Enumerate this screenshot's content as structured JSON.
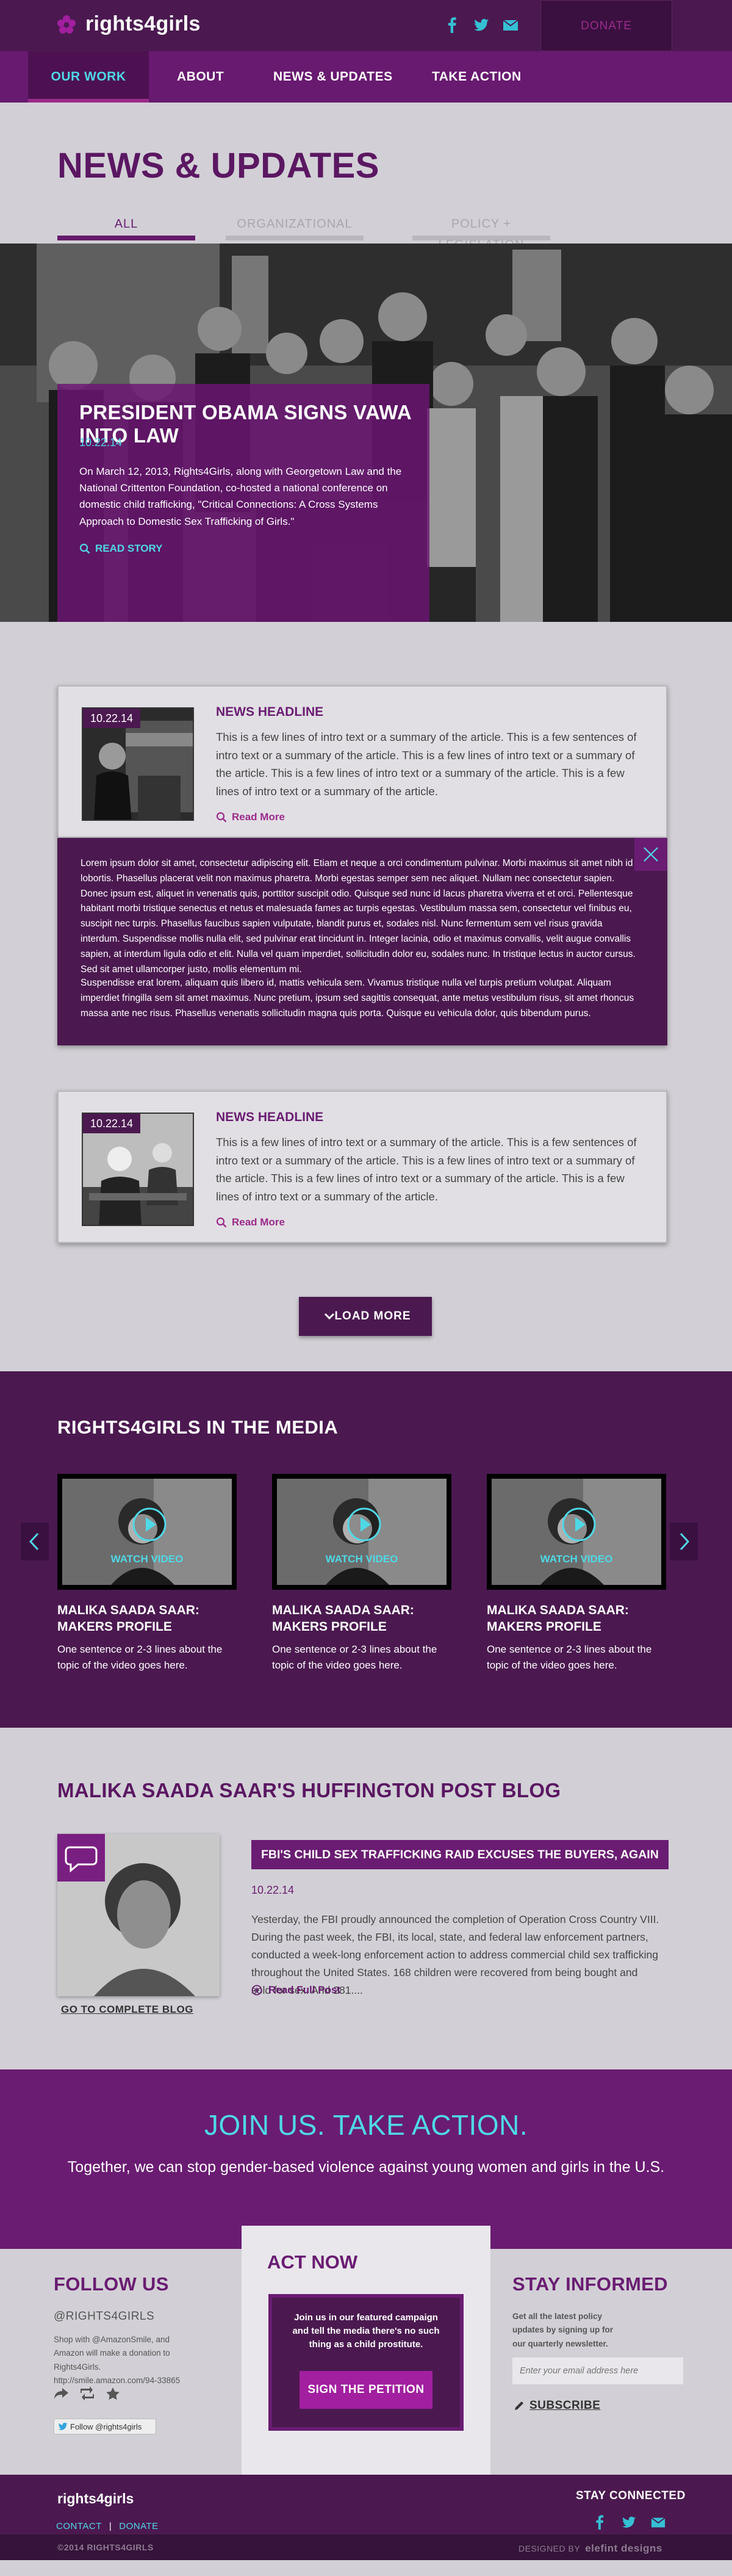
{
  "header": {
    "logo_text": "rights4girls",
    "social_icons": [
      "facebook-icon",
      "twitter-icon",
      "email-icon"
    ],
    "donate_label": "DONATE"
  },
  "nav": {
    "items": [
      {
        "label": "OUR WORK",
        "active": true
      },
      {
        "label": "ABOUT",
        "active": false
      },
      {
        "label": "NEWS & UPDATES",
        "active": false
      },
      {
        "label": "TAKE ACTION",
        "active": false
      }
    ]
  },
  "news": {
    "title": "NEWS & UPDATES",
    "filters": [
      {
        "label": "ALL",
        "active": true
      },
      {
        "label": "ORGANIZATIONAL",
        "active": false
      },
      {
        "label": "POLICY + LEGISLATION",
        "active": false
      }
    ]
  },
  "feature": {
    "title": "PRESIDENT OBAMA SIGNS VAWA INTO LAW",
    "date": "10.22.14",
    "body": "On March 12, 2013, Rights4Girls, along with Georgetown Law and the National Crittenton Foundation, co-hosted a national conference on domestic child trafficking, \"Critical Connections: A Cross Systems Approach to Domestic Sex Trafficking of Girls.\"",
    "read_story": "READ STORY"
  },
  "articles": [
    {
      "date": "10.22.14",
      "headline": "NEWS HEADLINE",
      "intro": "This is a few lines of intro text or a summary of the article. This is a few sentences of intro text or a summary of the article. This is a few lines of intro text or a summary of the article. This is a few lines of intro text or a summary of the article. This is a few lines of intro text or a summary of the article.",
      "read_more": "Read More"
    },
    {
      "date": "10.22.14",
      "headline": "NEWS HEADLINE",
      "intro": "This is a few lines of intro text or a summary of the article. This is a few sentences of intro text or a summary of the article. This is a few lines of intro text or a summary of the article. This is a few lines of intro text or a summary of the article. This is a few lines of intro text or a summary of the article.",
      "read_more": "Read More"
    }
  ],
  "expanded": {
    "para1": "Lorem ipsum dolor sit amet, consectetur adipiscing elit. Etiam et neque a orci condimentum pulvinar. Morbi maximus sit amet nibh id lobortis. Phasellus placerat velit non maximus pharetra. Morbi egestas semper sem nec aliquet. Nullam nec consectetur sapien. Donec ipsum est, aliquet in venenatis quis, porttitor suscipit odio. Quisque sed nunc id lacus pharetra viverra et et orci. Pellentesque habitant morbi tristique senectus et netus et malesuada fames ac turpis egestas. Vestibulum massa sem, consectetur vel finibus eu, suscipit nec turpis. Phasellus faucibus sapien vulputate, blandit purus et, sodales nisl. Nunc fermentum sem vel risus gravida interdum. Suspendisse mollis nulla elit, sed pulvinar erat tincidunt in. Integer lacinia, odio et maximus convallis, velit augue convallis sapien, at interdum ligula odio et elit. Nulla vel quam imperdiet, sollicitudin dolor eu, sodales nunc. In tristique lectus in auctor cursus. Sed sit amet ullamcorper justo, mollis elementum mi.",
    "para2": "Suspendisse erat lorem, aliquam quis libero id, mattis vehicula sem. Vivamus tristique nulla vel turpis pretium volutpat. Aliquam imperdiet fringilla sem sit amet maximus. Nunc pretium, ipsum sed sagittis consequat, ante metus vestibulum risus, sit amet rhoncus massa ante nec risus. Phasellus venenatis sollicitudin magna quis porta. Quisque eu vehicula dolor, quis bibendum purus."
  },
  "load_more": "LOAD MORE",
  "media": {
    "title": "RIGHTS4GIRLS IN THE MEDIA",
    "videos": [
      {
        "watch": "WATCH VIDEO",
        "title": "MALIKA SAADA SAAR: MAKERS PROFILE",
        "desc": "One sentence or 2-3 lines about the topic of the video goes here."
      },
      {
        "watch": "WATCH VIDEO",
        "title": "MALIKA SAADA SAAR: MAKERS PROFILE",
        "desc": "One sentence or 2-3 lines about the topic of the video goes here."
      },
      {
        "watch": "WATCH VIDEO",
        "title": "MALIKA SAADA SAAR: MAKERS PROFILE",
        "desc": "One sentence or 2-3 lines about the topic of the video goes here."
      }
    ]
  },
  "blog": {
    "title": "MALIKA SAADA SAAR'S HUFFINGTON POST BLOG",
    "link": "GO TO COMPLETE BLOG",
    "headline": "FBI'S CHILD SEX TRAFFICKING RAID EXCUSES THE BUYERS, AGAIN",
    "date": "10.22.14",
    "body": "Yesterday, the FBI proudly announced the completion of Operation Cross Country VIII. During the past week, the FBI, its local, state, and federal law enforcement partners, conducted a week-long enforcement action to address commercial child sex trafficking throughout the United States. 168 children were recovered from being bought and sold for sex. And 281....",
    "read_more": "Read Full Post"
  },
  "join": {
    "title": "JOIN US. TAKE ACTION.",
    "subtitle": "Together, we can stop gender-based violence against young women and girls in the U.S."
  },
  "follow": {
    "title": "FOLLOW US",
    "handle": "@RIGHTS4GIRLS",
    "text": "Shop with @AmazonSmile, and Amazon will make a donation to Rights4Girls. http://smile.amazon.com/94-33865",
    "icons": [
      "share-icon",
      "retweet-icon",
      "star-icon"
    ],
    "twitter_button": "Follow @rights4girls"
  },
  "act": {
    "title": "ACT NOW",
    "text": "Join us in our featured campaign and tell the media there's no such thing as a child prostitute.",
    "button": "SIGN THE PETITION"
  },
  "stay": {
    "title": "STAY INFORMED",
    "text": "Get all the latest policy updates by signing up for our quarterly newsletter.",
    "placeholder": "Enter your email address here",
    "subscribe": "SUBSCRIBE"
  },
  "footer": {
    "logo": "rights4girls",
    "links": [
      "CONTACT",
      "DONATE"
    ],
    "separator": "|",
    "stay_connected": "STAY CONNECTED",
    "icons": [
      "facebook-icon",
      "twitter-icon",
      "email-icon"
    ],
    "copyright": "©2014 RIGHTS4GIRLS",
    "designed_by": "DESIGNED BY",
    "designer": "elefint designs"
  },
  "colors": {
    "primary": "#6a1c72",
    "dark": "#4b1950",
    "accent": "#4fd8e6",
    "magenta": "#a21fa0",
    "background": "#d2d0d6"
  }
}
